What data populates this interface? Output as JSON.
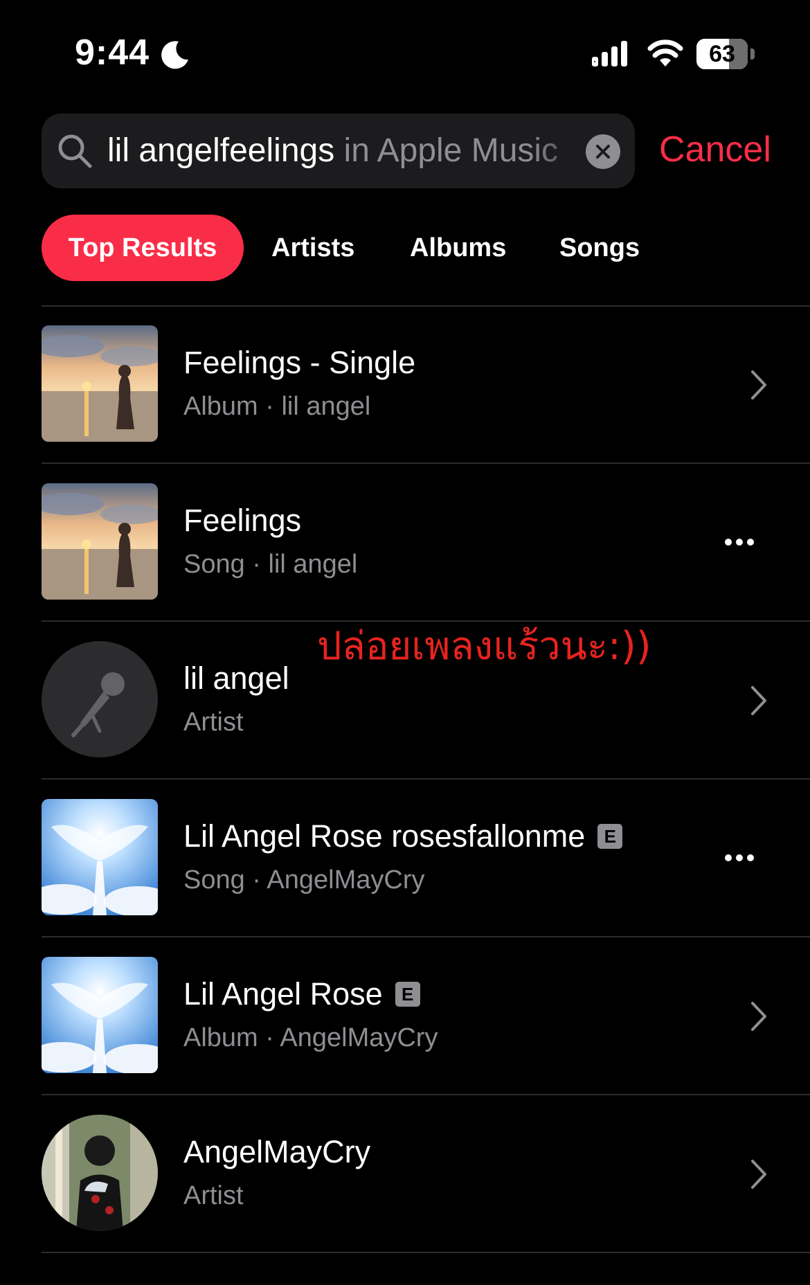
{
  "status_bar": {
    "time": "9:44",
    "battery_percent": "63",
    "battery_level": 0.63
  },
  "search": {
    "query": "lil angelfeelings",
    "suggestion": " in Apple Music",
    "cancel_label": "Cancel"
  },
  "tabs": [
    {
      "label": "Top Results",
      "active": true
    },
    {
      "label": "Artists",
      "active": false
    },
    {
      "label": "Albums",
      "active": false
    },
    {
      "label": "Songs",
      "active": false
    }
  ],
  "results": [
    {
      "title": "Feelings - Single",
      "subtitle": "Album · lil angel",
      "explicit": false,
      "art": "sunset-beach-girl",
      "accessory": "chevron-right-icon"
    },
    {
      "title": "Feelings",
      "subtitle": "Song · lil angel",
      "explicit": false,
      "art": "sunset-beach-girl",
      "accessory": "more-icon"
    },
    {
      "title": "lil angel",
      "subtitle": "Artist",
      "explicit": false,
      "art": "microphone-placeholder",
      "accessory": "chevron-right-icon"
    },
    {
      "title": "Lil Angel Rose rosesfallonme",
      "subtitle": "Song · AngelMayCry",
      "explicit": true,
      "explicit_badge": "E",
      "art": "angel-wings-stairs",
      "accessory": "more-icon"
    },
    {
      "title": "Lil Angel Rose",
      "subtitle": "Album · AngelMayCry",
      "explicit": true,
      "explicit_badge": "E",
      "art": "angel-wings-stairs",
      "accessory": "chevron-right-icon"
    },
    {
      "title": "AngelMayCry",
      "subtitle": "Artist",
      "explicit": false,
      "art": "artist-photo",
      "accessory": "chevron-right-icon"
    }
  ],
  "annotation": "ปล่อยเพลงแร้วนะ:))",
  "colors": {
    "accent": "#fa2d48",
    "background": "#000000",
    "secondary_text": "#8e8e93",
    "annotation": "#e8231f"
  }
}
